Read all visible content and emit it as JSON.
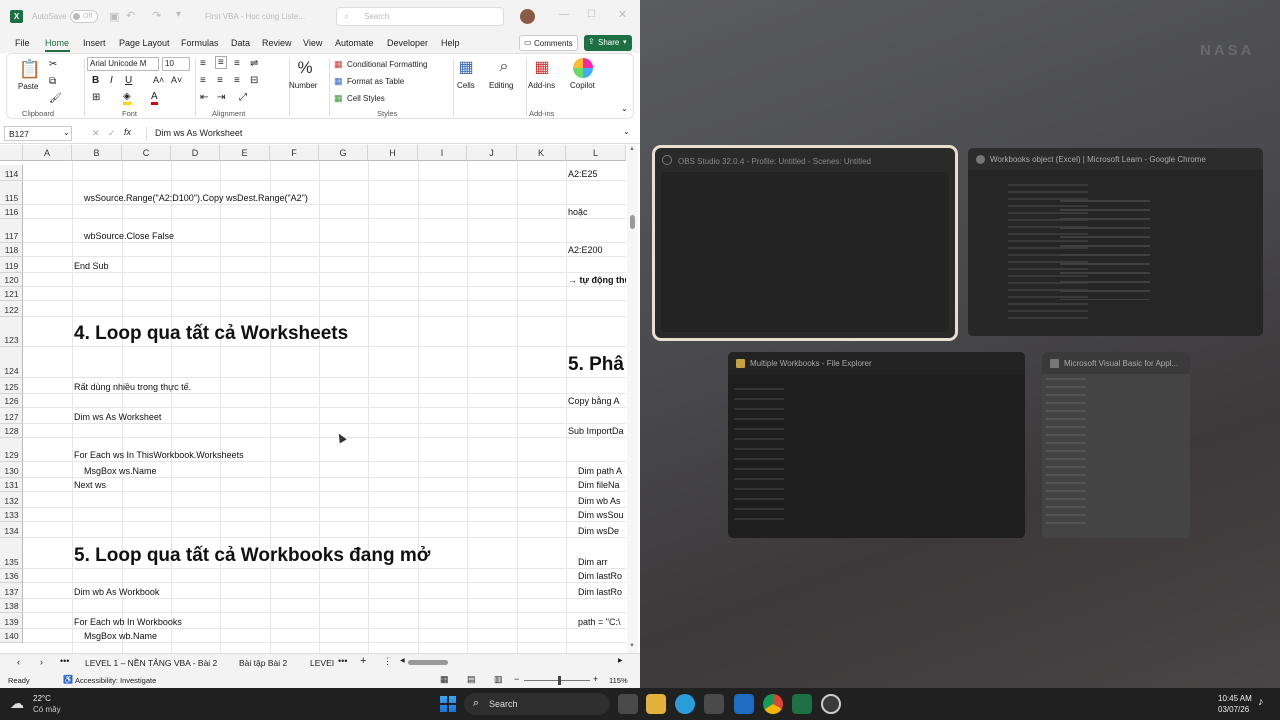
{
  "excel": {
    "titlebar": {
      "autosave_label": "AutoSave",
      "autosave_state": "Off",
      "file_title": "First VBA - Hoc cùng Liste...",
      "search_placeholder": "Search"
    },
    "menu": [
      "File",
      "Home",
      "Insert",
      "Page Layout",
      "Formulas",
      "Data",
      "Review",
      "View",
      "Automate",
      "Developer",
      "Help"
    ],
    "active_menu": "Home",
    "comments_label": "Comments",
    "share_label": "Share",
    "ribbon": {
      "paste": "Paste",
      "clipboard": "Clipboard",
      "font_name": "Arial Unicode M",
      "font_size": "10",
      "font": "Font",
      "alignment": "Alignment",
      "number": "Number",
      "conditional_formatting": "Conditional Formatting",
      "format_as_table": "Format as Table",
      "cell_styles": "Cell Styles",
      "styles": "Styles",
      "cells": "Cells",
      "editing": "Editing",
      "addins": "Add-ins",
      "addins_group": "Add-ins",
      "copilot": "Copilot"
    },
    "formula_bar": {
      "name_box": "B127",
      "fx": "fx",
      "formula": "Dim ws As Worksheet"
    },
    "columns": [
      "A",
      "B",
      "C",
      "D",
      "E",
      "F",
      "G",
      "H",
      "I",
      "J",
      "K",
      "L"
    ],
    "rows": [
      {
        "n": "114",
        "h": 16
      },
      {
        "n": "115",
        "h": 24
      },
      {
        "n": "116",
        "h": 14
      },
      {
        "n": "117",
        "h": 24
      },
      {
        "n": "118",
        "h": 14
      },
      {
        "n": "119",
        "h": 16
      },
      {
        "n": "120",
        "h": 14
      },
      {
        "n": "121",
        "h": 14
      },
      {
        "n": "122",
        "h": 16
      },
      {
        "n": "123",
        "h": 30
      },
      {
        "n": "124",
        "h": 31
      },
      {
        "n": "125",
        "h": 16
      },
      {
        "n": "126",
        "h": 14
      },
      {
        "n": "127",
        "h": 16
      },
      {
        "n": "128",
        "h": 14
      },
      {
        "n": "129",
        "h": 24
      },
      {
        "n": "130",
        "h": 16
      },
      {
        "n": "131",
        "h": 14
      },
      {
        "n": "132",
        "h": 16
      },
      {
        "n": "133",
        "h": 14
      },
      {
        "n": "134",
        "h": 16
      },
      {
        "n": "135",
        "h": 31
      },
      {
        "n": "136",
        "h": 14
      },
      {
        "n": "137",
        "h": 16
      },
      {
        "n": "138",
        "h": 14
      },
      {
        "n": "139",
        "h": 16
      },
      {
        "n": "140",
        "h": 14
      }
    ],
    "cells": {
      "b115": "wsSource.Range(\"A2:D100\").Copy wsDest.Range(\"A2\")",
      "b117": "wbSource.Close False",
      "b119": "End Sub",
      "b123": "4. Loop qua tất cả Worksheets",
      "b125": "Rất dùng nhiều trong thực tế.",
      "b127": "Dim ws As Worksheet",
      "b129": "For Each ws In ThisWorkbook.Worksheets",
      "b130": "MsgBox ws.Name",
      "b131": "Next ws",
      "b135": "5. Loop qua tất cả Workbooks đang mở",
      "b137": "Dim wb As Workbook",
      "b139": "For Each wb In Workbooks",
      "b140": "MsgBox wb.Name",
      "l114": "A2:E25",
      "l116": "hoặc",
      "l118": "A2:E200",
      "l120": "→ tự động thu",
      "l124": "5. Phâ",
      "l126": "Copy bằng A",
      "l128": "Sub ImportDa",
      "l130": "Dim path A",
      "l131": "Dim fileNa",
      "l132": "Dim wb As",
      "l133": "Dim wsSou",
      "l134": "Dim wsDe",
      "l135": "Dim arr",
      "l136": "Dim lastRo",
      "l137": "Dim lastRo",
      "l139": "path = \"C:\\"
    },
    "sheet_tabs": [
      "LEVEL 1 – NỀN TẢNG VBA - Bài 2",
      "Bài tập Bài 2",
      "LEVEI"
    ],
    "status": {
      "ready": "Ready",
      "accessibility": "Accessibility: Investigate",
      "zoom": "115%"
    }
  },
  "task_view": {
    "nasa_label": "NASA",
    "windows": [
      {
        "title": "OBS Studio 32.0.4 - Profile: Untitled - Scenes: Untitled",
        "selected": true
      },
      {
        "title": "Workbooks object (Excel) | Microsoft Learn - Google Chrome",
        "selected": false
      },
      {
        "title": "Multiple Workbooks - File Explorer",
        "selected": false
      },
      {
        "title": "Microsoft Visual Basic for Appl...",
        "selected": false
      }
    ]
  },
  "taskbar": {
    "temperature": "22°C",
    "weather": "Có mây",
    "search": "Search",
    "time": "10:45 AM",
    "date": "03/07/26"
  }
}
